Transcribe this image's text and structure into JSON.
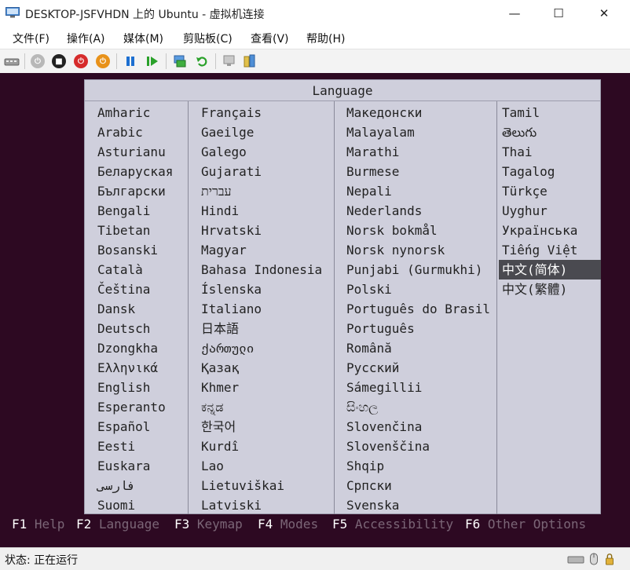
{
  "window": {
    "title": "DESKTOP-JSFVHDN 上的 Ubuntu - 虚拟机连接",
    "minimize_glyph": "—",
    "maximize_glyph": "☐",
    "close_glyph": "✕"
  },
  "menu": [
    "文件(F)",
    "操作(A)",
    "媒体(M)",
    "剪贴板(C)",
    "查看(V)",
    "帮助(H)"
  ],
  "toolbar": {
    "icons": [
      "ctrl-alt-del-icon",
      "start-icon",
      "turn-off-icon",
      "shut-down-icon",
      "save-icon",
      "pause-icon",
      "resume-icon",
      "checkpoint-icon",
      "revert-icon",
      "enhanced-session-icon",
      "share-icon"
    ]
  },
  "installer": {
    "dialog_title": "Language",
    "columns": [
      [
        "Amharic",
        "Arabic",
        "Asturianu",
        "Беларуская",
        "Български",
        "Bengali",
        "Tibetan",
        "Bosanski",
        "Català",
        "Čeština",
        "Dansk",
        "Deutsch",
        "Dzongkha",
        "Ελληνικά",
        "English",
        "Esperanto",
        "Español",
        "Eesti",
        "Euskara",
        "فارسی",
        "Suomi"
      ],
      [
        "Français",
        "Gaeilge",
        "Galego",
        "Gujarati",
        "עברית",
        "Hindi",
        "Hrvatski",
        "Magyar",
        "Bahasa Indonesia",
        "Íslenska",
        "Italiano",
        "日本語",
        "ქართული",
        "Қазақ",
        "Khmer",
        "ಕನ್ನಡ",
        "한국어",
        "Kurdî",
        "Lao",
        "Lietuviškai",
        "Latviski"
      ],
      [
        "Македонски",
        "Malayalam",
        "Marathi",
        "Burmese",
        "Nepali",
        "Nederlands",
        "Norsk bokmål",
        "Norsk nynorsk",
        "Punjabi (Gurmukhi)",
        "Polski",
        "Português do Brasil",
        "Português",
        "Română",
        "Русский",
        "Sámegillii",
        "සිංහල",
        "Slovenčina",
        "Slovenščina",
        "Shqip",
        "Српски",
        "Svenska"
      ],
      [
        "Tamil",
        "తెలుగు",
        "Thai",
        "Tagalog",
        "Türkçe",
        "Uyghur",
        "Українська",
        "Tiếng Việt",
        "中文(简体)",
        "中文(繁體)"
      ]
    ],
    "selected_language": "中文(简体)",
    "function_keys": [
      {
        "key": "F1",
        "label": "Help"
      },
      {
        "key": "F2",
        "label": "Language"
      },
      {
        "key": "F3",
        "label": "Keymap"
      },
      {
        "key": "F4",
        "label": "Modes"
      },
      {
        "key": "F5",
        "label": "Accessibility"
      },
      {
        "key": "F6",
        "label": "Other Options"
      }
    ]
  },
  "statusbar": {
    "status_label": "状态: 正在运行",
    "icons": [
      "keyboard-icon",
      "mouse-icon",
      "lock-icon"
    ]
  },
  "colors": {
    "vm_background": "#2d0922",
    "dialog_background": "#cfcfdc",
    "selection": "#4a4a50",
    "fkey_label": "#7b6677"
  }
}
